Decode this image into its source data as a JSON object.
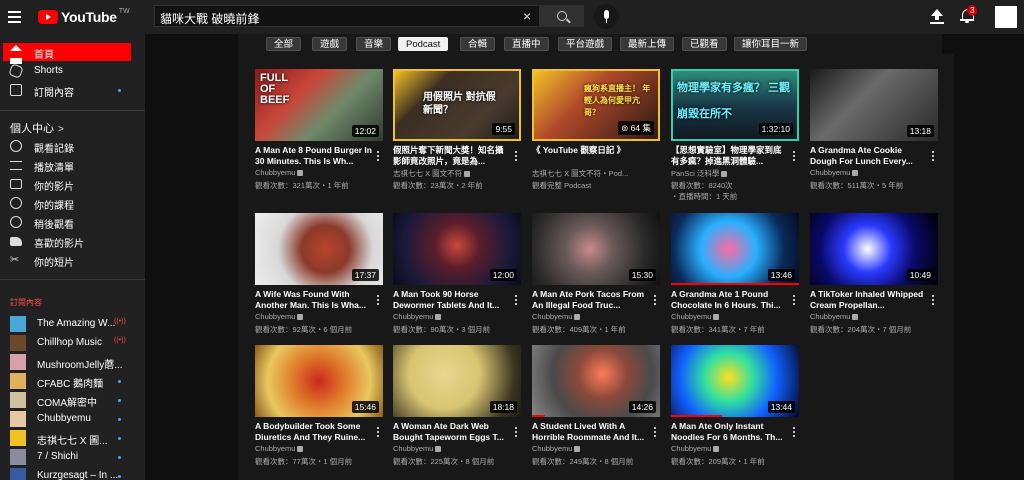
{
  "app": {
    "logo_text": "YouTube",
    "region": "TW"
  },
  "search": {
    "value": "貓咪大戰 破曉前鋒",
    "clear_icon": "×"
  },
  "header": {
    "notifications_count": "3"
  },
  "sidebar": {
    "main_items": [
      {
        "label": "首頁",
        "icon": "home-icon",
        "active": true
      },
      {
        "label": "Shorts",
        "icon": "shorts-icon"
      },
      {
        "label": "訂閱內容",
        "icon": "subscriptions-icon",
        "dot": true
      }
    ],
    "you_section_title": "個人中心",
    "you_items": [
      {
        "label": "觀看記錄",
        "icon": "history-icon"
      },
      {
        "label": "播放清單",
        "icon": "playlist-icon"
      },
      {
        "label": "你的影片",
        "icon": "your-videos-icon"
      },
      {
        "label": "你的課程",
        "icon": "courses-icon"
      },
      {
        "label": "稍後觀看",
        "icon": "watch-later-icon"
      },
      {
        "label": "喜歡的影片",
        "icon": "like-icon"
      },
      {
        "label": "你的短片",
        "icon": "clips-icon"
      }
    ],
    "subscriptions_title": "訂閱內容",
    "subscriptions": [
      {
        "name": "The Amazing W...",
        "live": true,
        "color": "#4aa8d8"
      },
      {
        "name": "Chillhop Music",
        "live": true,
        "color": "#6a4a2a"
      },
      {
        "name": "MushroomJelly蘑...",
        "color": "#d8a0a8"
      },
      {
        "name": "CFABC 鵝肉麵",
        "dot": true,
        "color": "#e0b060"
      },
      {
        "name": "COMA解密中",
        "dot": true,
        "color": "#d0c0a0"
      },
      {
        "name": "Chubbyemu",
        "dot": true,
        "color": "#e8c8a0"
      },
      {
        "name": "志祺七七 X 圖...",
        "dot": true,
        "color": "#f2c027"
      },
      {
        "name": "7 / Shichi",
        "dot": true,
        "color": "#8a8aa0"
      },
      {
        "name": "Kurzgesagt – In ...",
        "dot": true,
        "color": "#3a5aa0"
      }
    ]
  },
  "chips": [
    "全部",
    "遊戲",
    "音樂",
    "Podcast",
    "合輯",
    "直播中",
    "平台遊戲",
    "最新上傳",
    "已觀看",
    "讓你耳目一新"
  ],
  "active_chip": "Podcast",
  "videos": [
    {
      "title": "A Man Ate 8 Pound Burger In 30 Minutes. This Is Wh...",
      "channel": "Chubbyemu",
      "meta": "觀看次數：321萬次・1 年前",
      "duration": "12:02",
      "thumb_text": "FULL OF BEEF",
      "progress": 0
    },
    {
      "title": "假照片奪下新聞大獎！知名攝影師竟改照片，竟是為...",
      "channel": "志祺七七 X 圖文不符",
      "meta": "觀看次數：23萬次・2 年前",
      "duration": "9:55",
      "thumb_text": "用假照片 對抗假新聞？",
      "progress": 0
    },
    {
      "title": "《 YouTube 觀察日記 》",
      "channel": "志祺七七 X 圖文不符・Pod...",
      "meta": "觀看完整 Podcast",
      "duration": "64 集",
      "thumb_text": "瘋狗系直播主！ 年輕人為何愛甲亢哥？",
      "progress": 0
    },
    {
      "title": "【思想實驗室】物理學家到底有多瘋？掉進黑洞體驗...",
      "channel": "PanSci 泛科學",
      "meta": "觀看次數：8240次",
      "meta2": "・直播時間：1 天前",
      "duration": "1:32:10",
      "thumb_text": "物理學家有多瘋？ 三觀崩毀在所不",
      "progress": 0
    },
    {
      "title": "A Grandma Ate Cookie Dough For Lunch Every...",
      "channel": "Chubbyemu",
      "meta": "觀看次數：511萬次・5 年前",
      "duration": "13:18",
      "thumb_text": "",
      "progress": 0
    },
    {
      "title": "A Wife Was Found With Another Man. This Is Wha...",
      "channel": "Chubbyemu",
      "meta": "觀看次數：92萬次・6 個月前",
      "duration": "17:37",
      "thumb_text": "",
      "progress": 0
    },
    {
      "title": "A Man Took 90 Horse Dewormer Tablets And It...",
      "channel": "Chubbyemu",
      "meta": "觀看次數：90萬次・3 個月前",
      "duration": "12:00",
      "thumb_text": "",
      "progress": 0
    },
    {
      "title": "A Man Ate Pork Tacos From An Illegal Food Truc...",
      "channel": "Chubbyemu",
      "meta": "觀看次數：409萬次・1 年前",
      "duration": "15:30",
      "thumb_text": "",
      "progress": 0
    },
    {
      "title": "A Grandma Ate 1 Pound Chocolate In 6 Hours. Thi...",
      "channel": "Chubbyemu",
      "meta": "觀看次數：341萬次・7 年前",
      "duration": "13:46",
      "thumb_text": "",
      "progress": 1.0
    },
    {
      "title": "A TikToker Inhaled Whipped Cream Propellan...",
      "channel": "Chubbyemu",
      "meta": "觀看次數：204萬次・7 個月前",
      "duration": "10:49",
      "thumb_text": "",
      "progress": 0
    },
    {
      "title": "A Bodybuilder Took Some Diuretics And They Ruine...",
      "channel": "Chubbyemu",
      "meta": "觀看次數：77萬次・1 個月前",
      "duration": "15:46",
      "thumb_text": "",
      "progress": 0
    },
    {
      "title": "A Woman Ate Dark Web Bought Tapeworm Eggs T...",
      "channel": "Chubbyemu",
      "meta": "觀看次數：225萬次・8 個月前",
      "duration": "18:18",
      "thumb_text": "",
      "progress": 0
    },
    {
      "title": "A Student Lived With A Horrible Roommate And It...",
      "channel": "Chubbyemu",
      "meta": "觀看次數：249萬次・8 個月前",
      "duration": "14:26",
      "thumb_text": "",
      "progress": 0.1
    },
    {
      "title": "A Man Ate Only Instant Noodles For 6 Months. Th...",
      "channel": "Chubbyemu",
      "meta": "觀看次數：209萬次・1 年前",
      "duration": "13:44",
      "thumb_text": "",
      "progress": 0.4
    }
  ]
}
